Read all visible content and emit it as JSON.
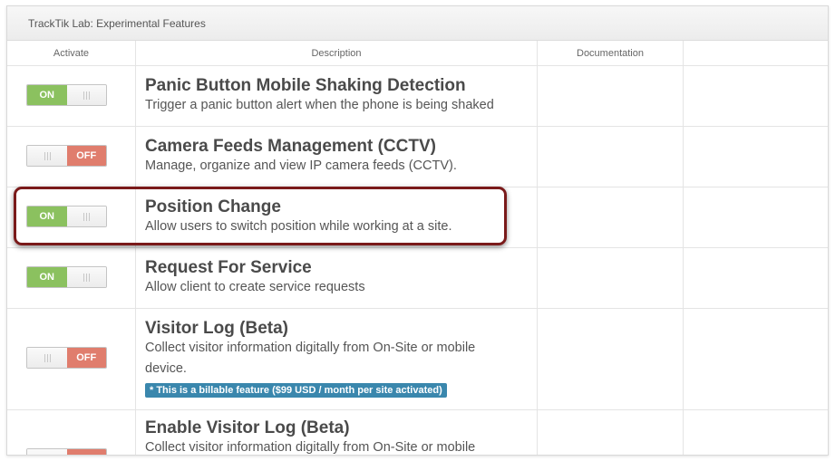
{
  "panel": {
    "title": "TrackTik Lab: Experimental Features"
  },
  "columns": {
    "activate": "Activate",
    "description": "Description",
    "documentation": "Documentation"
  },
  "features": [
    {
      "title": "Panic Button Mobile Shaking Detection",
      "description": "Trigger a panic button alert when the phone is being shaked",
      "state": "ON"
    },
    {
      "title": "Camera Feeds Management (CCTV)",
      "description": "Manage, organize and view IP camera feeds (CCTV).",
      "state": "OFF"
    },
    {
      "title": "Position Change",
      "description": "Allow users to switch position while working at a site.",
      "state": "ON"
    },
    {
      "title": "Request For Service",
      "description": "Allow client to create service requests",
      "state": "ON"
    },
    {
      "title": "Visitor Log (Beta)",
      "description": "Collect visitor information digitally from On-Site or mobile device.",
      "state": "OFF",
      "badge": "* This is a billable feature ($99 USD / month per site activated)"
    },
    {
      "title": "Enable Visitor Log (Beta)",
      "description": "Collect visitor information digitally from On-Site or mobile",
      "state": "OFF"
    }
  ],
  "colors": {
    "on": "#8bc15f",
    "off": "#e07d6d",
    "badge": "#3a87ad",
    "highlight": "#7a1a1a"
  },
  "icons": {
    "toggle_handle": "grip-lines-icon"
  }
}
